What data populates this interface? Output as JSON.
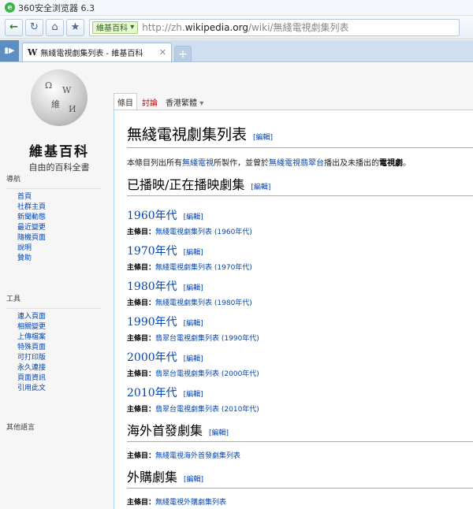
{
  "browser": {
    "title": "360安全浏览器 6.3",
    "site_badge": "維基百科",
    "url_scheme": "http://zh.",
    "url_host": "wikipedia.org",
    "url_path": "/wiki/無綫電視劇集列表",
    "tab_title": "無綫電視劇集列表 - 維基百科",
    "tab_icon": "W"
  },
  "logo": {
    "name": "維基百科",
    "tagline": "自由的百科全書"
  },
  "sidebar": {
    "nav_heading": "導航",
    "nav_items": [
      "首頁",
      "社群主頁",
      "新聞動態",
      "最近變更",
      "隨機頁面",
      "說明",
      "贊助"
    ],
    "tools_heading": "工具",
    "tools_items": [
      "連入頁面",
      "相關變更",
      "上傳檔案",
      "特殊頁面",
      "可打印版",
      "永久連接",
      "頁面資訊",
      "引用此文"
    ],
    "lang_heading": "其他語言"
  },
  "page_tabs": {
    "article": "條目",
    "talk": "討論",
    "variant": "香港繁體"
  },
  "article": {
    "title": "無綫電視劇集列表",
    "edit_label": "[編輯]",
    "lead_prefix": "本條目列出所有",
    "lead_link1": "無綫電視",
    "lead_mid": "所製作，並曾於",
    "lead_link2": "無綫電視翡翠台",
    "lead_mid2": "播出及未播出的",
    "lead_bold": "電視劇",
    "lead_end": "。",
    "main_label": "主條目：",
    "section1": "已播映/正在播映劇集",
    "decades": [
      {
        "heading": "1960年代",
        "main": "無綫電視劇集列表 (1960年代)"
      },
      {
        "heading": "1970年代",
        "main": "無綫電視劇集列表 (1970年代)"
      },
      {
        "heading": "1980年代",
        "main": "無綫電視劇集列表 (1980年代)"
      },
      {
        "heading": "1990年代",
        "main": "翡翠台電視劇集列表 (1990年代)"
      },
      {
        "heading": "2000年代",
        "main": "翡翠台電視劇集列表 (2000年代)"
      },
      {
        "heading": "2010年代",
        "main": "翡翠台電視劇集列表 (2010年代)"
      }
    ],
    "section2": "海外首發劇集",
    "section2_main": "無綫電視海外首發劇集列表",
    "section3": "外購劇集",
    "section3_main": "無綫電視外購劇集列表"
  }
}
